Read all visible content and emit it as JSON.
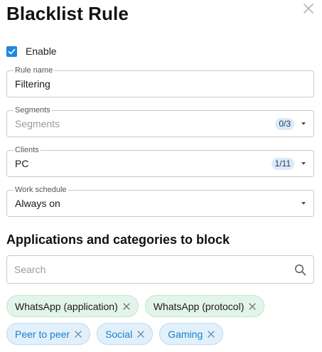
{
  "dialog": {
    "title": "Blacklist Rule"
  },
  "enable": {
    "label": "Enable",
    "checked": true
  },
  "fields": {
    "rule_name": {
      "label": "Rule name",
      "value": "Filtering"
    },
    "segments": {
      "label": "Segments",
      "placeholder": "Segments",
      "count": "0/3"
    },
    "clients": {
      "label": "Clients",
      "value": "PC",
      "count": "1/11"
    },
    "work_schedule": {
      "label": "Work schedule",
      "value": "Always on"
    }
  },
  "block_section": {
    "title": "Applications and categories to block",
    "search_placeholder": "Search",
    "applications": [
      {
        "label": "WhatsApp (application)"
      },
      {
        "label": "WhatsApp (protocol)"
      }
    ],
    "categories": [
      {
        "label": "Peer to peer"
      },
      {
        "label": "Social"
      },
      {
        "label": "Gaming"
      }
    ]
  },
  "colors": {
    "accent": "#1e88e5",
    "app_chip_bg": "#e3f5ea",
    "category_chip_bg": "#e2f0fb",
    "category_chip_text": "#1b7fc8"
  },
  "icons": {
    "close": "close-icon",
    "check": "check-icon",
    "dropdown": "caret-down-icon",
    "search": "search-icon",
    "remove": "remove-x-icon"
  }
}
